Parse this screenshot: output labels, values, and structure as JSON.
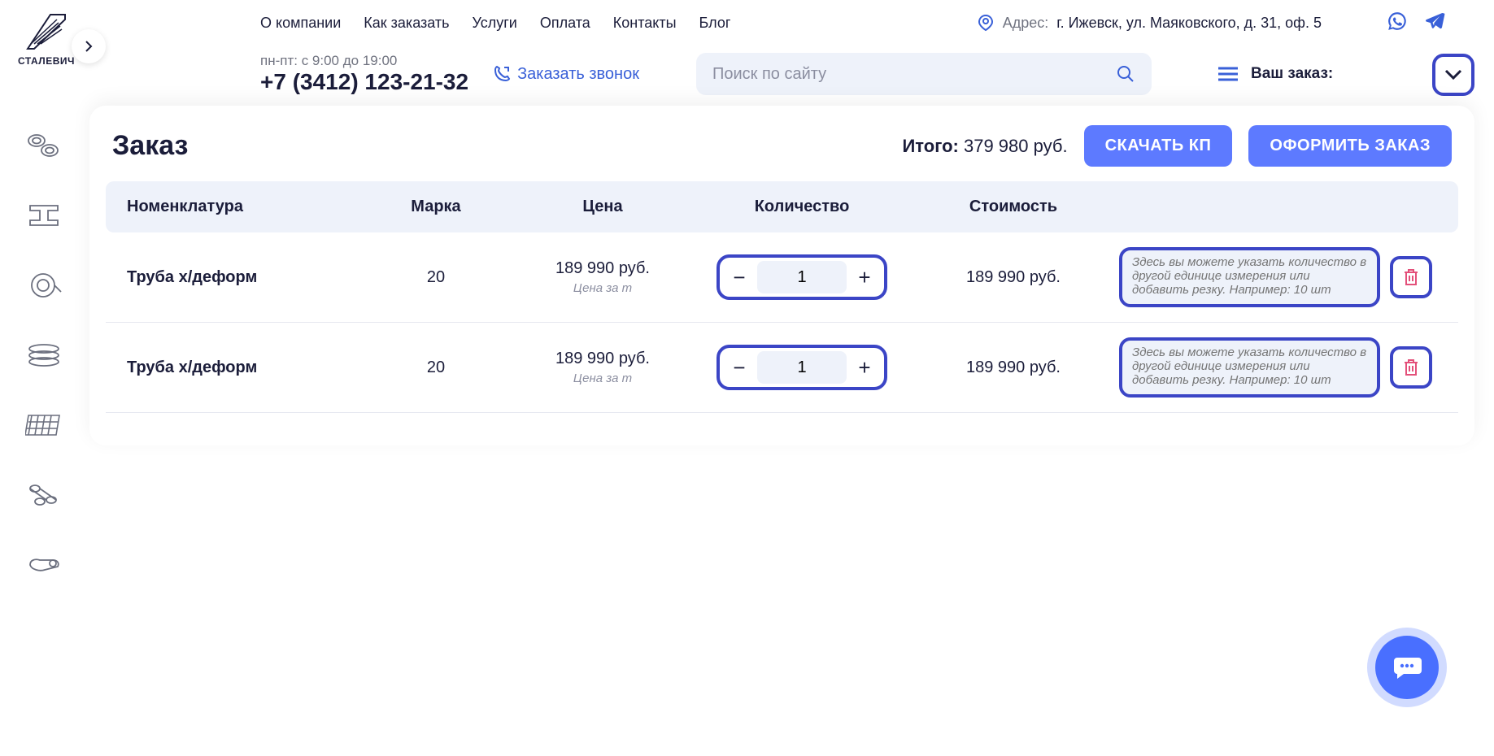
{
  "logo_name": "СТАЛЕВИЧ",
  "nav": {
    "about": "О компании",
    "how": "Как заказать",
    "services": "Услуги",
    "payment": "Оплата",
    "contacts": "Контакты",
    "blog": "Блог"
  },
  "address": {
    "label": "Адрес:",
    "value": "г. Ижевск, ул. Маяковского, д. 31, оф. 5"
  },
  "hours": "пн-пт: с 9:00 до 19:00",
  "phone": "+7 (3412) 123-21-32",
  "callback": "Заказать звонок",
  "search_placeholder": "Поиск по сайту",
  "your_order_label": "Ваш заказ:",
  "order": {
    "title": "Заказ",
    "total_label": "Итого:",
    "total_value": "379 980 руб.",
    "download_btn": "СКАЧАТЬ КП",
    "submit_btn": "ОФОРМИТЬ ЗАКАЗ",
    "columns": {
      "name": "Номенклатура",
      "brand": "Марка",
      "price": "Цена",
      "qty": "Количество",
      "cost": "Стоимость"
    },
    "note_placeholder": "Здесь вы можете указать количество в другой единице измерения или добавить резку. Например: 10 шт",
    "rows": [
      {
        "name": "Труба х/деформ",
        "brand": "20",
        "price": "189 990 руб.",
        "per": "Цена за т",
        "qty": "1",
        "cost": "189 990 руб."
      },
      {
        "name": "Труба х/деформ",
        "brand": "20",
        "price": "189 990 руб.",
        "per": "Цена за т",
        "qty": "1",
        "cost": "189 990 руб."
      }
    ]
  }
}
